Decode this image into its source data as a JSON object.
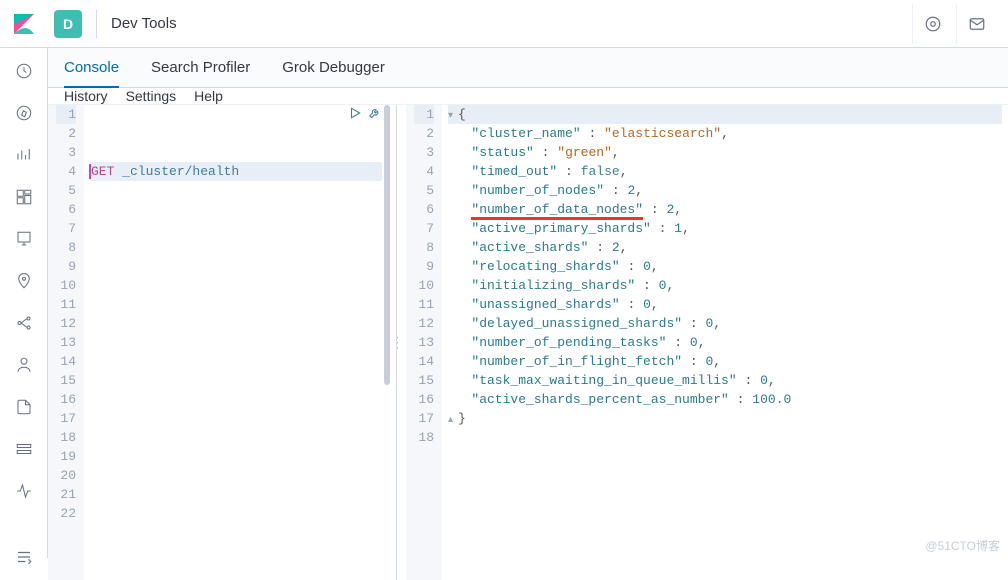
{
  "header": {
    "badge": "D",
    "title": "Dev Tools"
  },
  "tabs": {
    "console": "Console",
    "profiler": "Search Profiler",
    "grok": "Grok Debugger"
  },
  "subbar": {
    "history": "History",
    "settings": "Settings",
    "help": "Help"
  },
  "request": {
    "method": "GET",
    "path": "_cluster/health"
  },
  "response": {
    "cluster_name": "elasticsearch",
    "status": "green",
    "timed_out": false,
    "number_of_nodes": 2,
    "number_of_data_nodes": 2,
    "active_primary_shards": 1,
    "active_shards": 2,
    "relocating_shards": 0,
    "initializing_shards": 0,
    "unassigned_shards": 0,
    "delayed_unassigned_shards": 0,
    "number_of_pending_tasks": 0,
    "number_of_in_flight_fetch": 0,
    "task_max_waiting_in_queue_millis": 0,
    "active_shards_percent_as_number": 100.0
  },
  "response_order": [
    "cluster_name",
    "status",
    "timed_out",
    "number_of_nodes",
    "number_of_data_nodes",
    "active_primary_shards",
    "active_shards",
    "relocating_shards",
    "initializing_shards",
    "unassigned_shards",
    "delayed_unassigned_shards",
    "number_of_pending_tasks",
    "number_of_in_flight_fetch",
    "task_max_waiting_in_queue_millis",
    "active_shards_percent_as_number"
  ],
  "highlight_key": "number_of_data_nodes",
  "left_line_count": 22,
  "watermark": "@51CTO博客"
}
